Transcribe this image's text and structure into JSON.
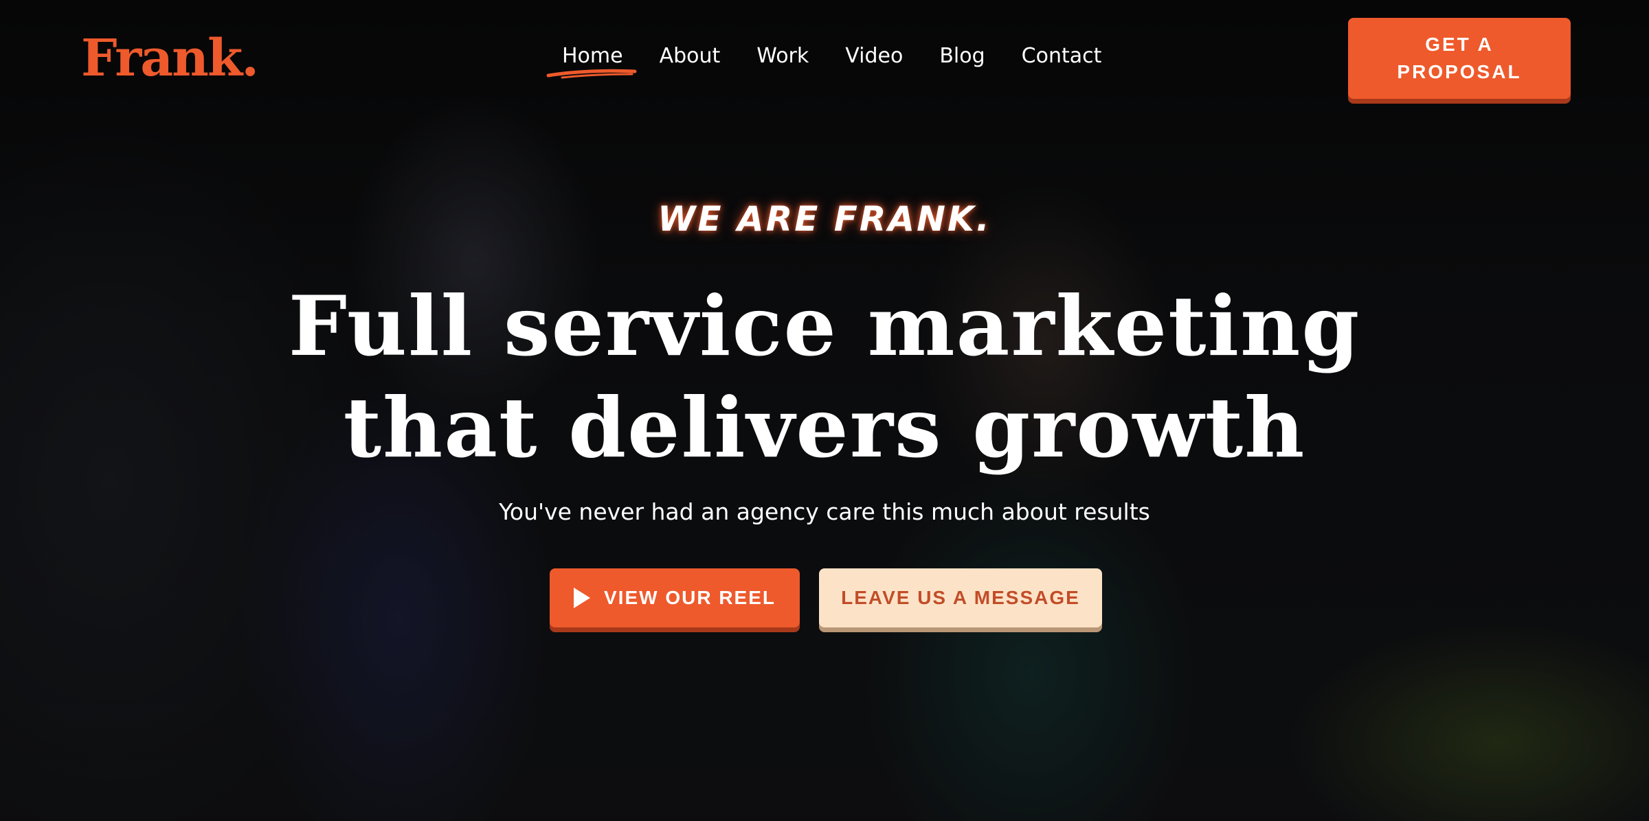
{
  "brand": {
    "name": "Frank",
    "dot": ".",
    "accent_color": "#ee5a2c",
    "cream_color": "#fce3c8"
  },
  "nav": {
    "items": [
      {
        "label": "Home",
        "active": true
      },
      {
        "label": "About"
      },
      {
        "label": "Work"
      },
      {
        "label": "Video"
      },
      {
        "label": "Blog"
      },
      {
        "label": "Contact"
      }
    ]
  },
  "header_cta": {
    "line1": "GET A",
    "line2": "PROPOSAL"
  },
  "hero": {
    "eyebrow": "WE ARE FRANK.",
    "headline_line1": "Full service marketing",
    "headline_line2": "that delivers growth",
    "subhead": "You've never had an agency care this much about results",
    "primary_button": {
      "label": "VIEW OUR REEL",
      "icon": "play-icon"
    },
    "secondary_button": {
      "label": "LEAVE US A MESSAGE"
    }
  }
}
